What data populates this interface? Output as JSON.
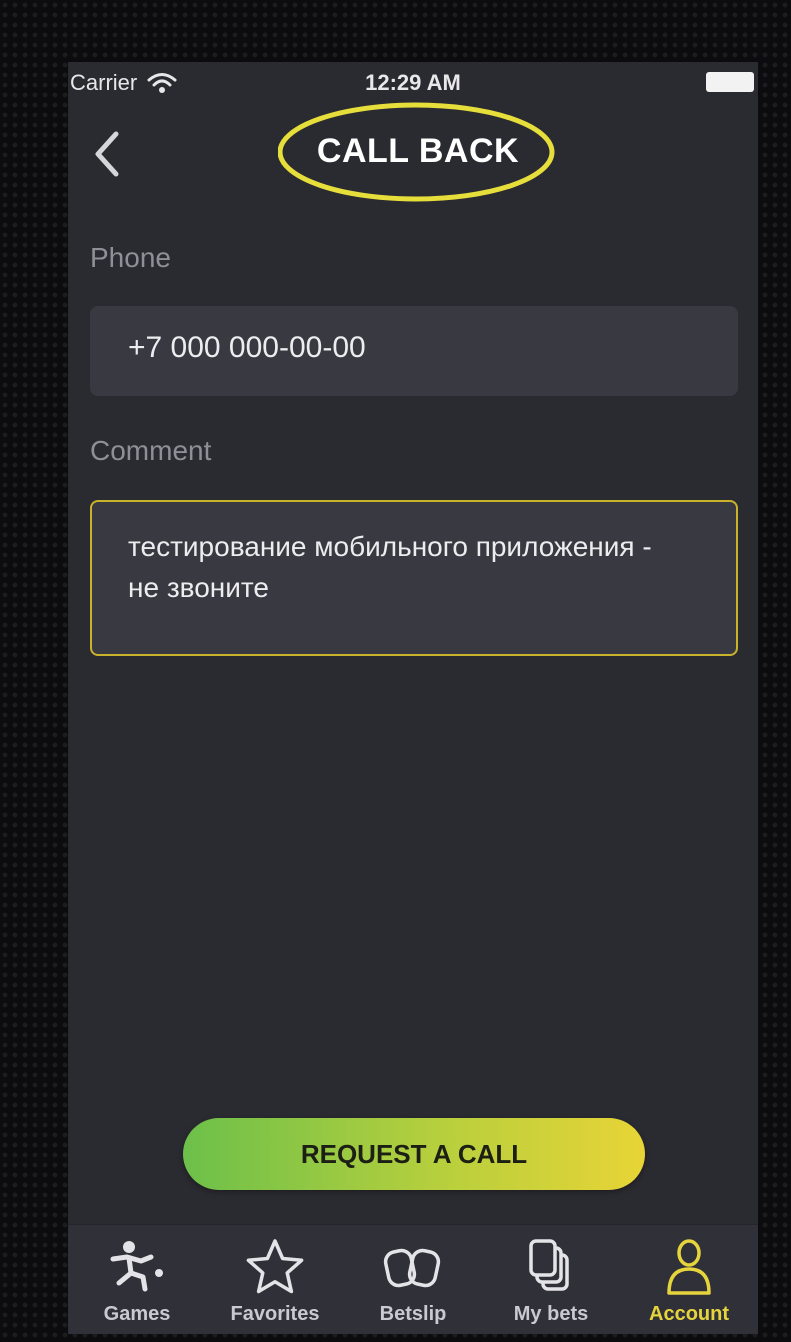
{
  "status_bar": {
    "carrier": "Carrier",
    "time": "12:29 AM",
    "wifi_icon": "wifi-icon",
    "battery_icon": "battery-icon"
  },
  "header": {
    "back_icon": "chevron-left-icon",
    "title": "CALL BACK",
    "highlight_color": "#e6de3a"
  },
  "form": {
    "phone_label": "Phone",
    "phone_value": "+7 000 000-00-00",
    "comment_label": "Comment",
    "comment_value": "тестирование мобильного приложения - не звоните",
    "focus_border_color": "#c9b32b"
  },
  "request_button": {
    "label": "REQUEST A CALL",
    "gradient_start": "#6cc04a",
    "gradient_end": "#e8d436"
  },
  "tab_bar": {
    "active_color": "#e6d43c",
    "items": [
      {
        "label": "Games",
        "icon": "soccer-player-icon",
        "active": false
      },
      {
        "label": "Favorites",
        "icon": "star-icon",
        "active": false
      },
      {
        "label": "Betslip",
        "icon": "betslip-icon",
        "active": false
      },
      {
        "label": "My bets",
        "icon": "stacked-cards-icon",
        "active": false
      },
      {
        "label": "Account",
        "icon": "person-icon",
        "active": true
      }
    ]
  }
}
